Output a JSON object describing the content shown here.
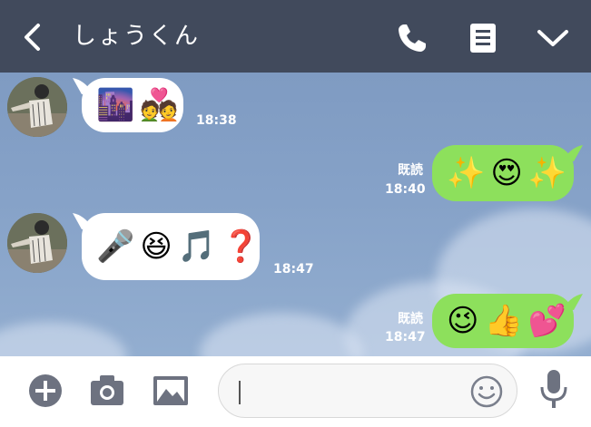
{
  "header": {
    "title": "しょうくん",
    "icons": [
      "back-arrow-icon",
      "phone-icon",
      "notes-icon",
      "chevron-down-icon"
    ]
  },
  "colors": {
    "header_bg": "#414a5c",
    "chat_bg": "#86a2c8",
    "incoming_bubble": "#ffffff",
    "outgoing_bubble": "#8de05c"
  },
  "messages": [
    {
      "direction": "in",
      "emoji": [
        "🌆",
        "💑"
      ],
      "time": "18:38"
    },
    {
      "direction": "out",
      "emoji": [
        "✨",
        "😍",
        "✨"
      ],
      "read_label": "既読",
      "time": "18:40"
    },
    {
      "direction": "in",
      "emoji": [
        "🎤",
        "😆",
        "🎵",
        "❓"
      ],
      "time": "18:47"
    },
    {
      "direction": "out",
      "emoji": [
        "😉",
        "👍",
        "💕"
      ],
      "read_label": "既読",
      "time": "18:47"
    }
  ],
  "footer": {
    "message_input_value": "",
    "icons": [
      "add-icon",
      "camera-icon",
      "image-icon",
      "emoji-icon",
      "microphone-icon"
    ]
  }
}
